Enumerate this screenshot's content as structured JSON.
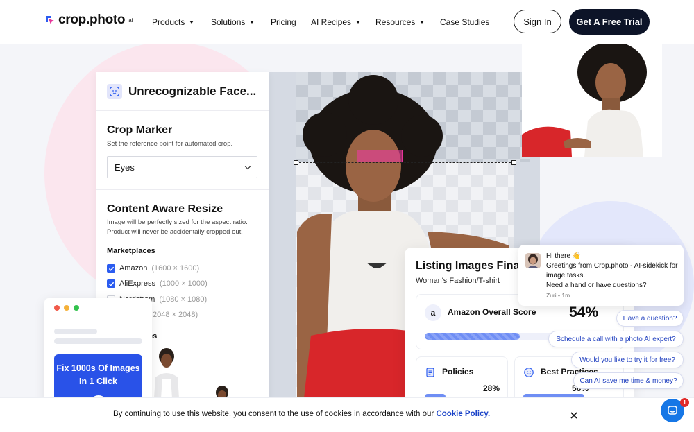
{
  "brand": {
    "name": "crop.photo",
    "sup": "ai"
  },
  "nav": {
    "items": [
      {
        "label": "Products",
        "has_caret": true
      },
      {
        "label": "Solutions",
        "has_caret": true
      },
      {
        "label": "Pricing",
        "has_caret": false
      },
      {
        "label": "AI Recipes",
        "has_caret": true
      },
      {
        "label": "Resources",
        "has_caret": true
      },
      {
        "label": "Case Studies",
        "has_caret": false
      }
    ],
    "signin_label": "Sign In",
    "trial_label": "Get A Free Trial"
  },
  "panel": {
    "title": "Unrecognizable Face...",
    "crop_marker": {
      "title": "Crop Marker",
      "subtitle": "Set the reference point for automated crop.",
      "selected": "Eyes"
    },
    "resize": {
      "title": "Content Aware Resize",
      "subtitle_1": "Image will be perfectly sized for the aspect ratio.",
      "subtitle_2": "Product will never be accidentally cropped out."
    },
    "marketplaces": {
      "title": "Marketplaces",
      "items": [
        {
          "name": "Amazon",
          "dims": "(1600 × 1600)",
          "checked": true
        },
        {
          "name": "AliExpress",
          "dims": "(1000 × 1000)",
          "checked": true
        },
        {
          "name": "Nordstrom",
          "dims": "(1080 × 1080)",
          "checked": false
        },
        {
          "name": "",
          "dims": "2048 × 2048)",
          "checked": false
        }
      ],
      "partial": "es"
    }
  },
  "listing": {
    "title": "Listing Images Final",
    "subtitle": "Woman's Fashion/T-shirt",
    "amazon_score": {
      "label": "Amazon Overall Score",
      "value": "54%",
      "fill": 0.49
    },
    "policies": {
      "label": "Policies",
      "value": "28%",
      "fill": 0.28
    },
    "best_practices": {
      "label": "Best Practices",
      "value": "56%",
      "fill": 0.6
    }
  },
  "mock": {
    "cta": "Fix 1000s Of Images In 1 Click"
  },
  "chat": {
    "greeting": "Hi there 👋",
    "line1": "Greetings from Crop.photo - AI-sidekick for image tasks.",
    "line2": "Need a hand or have questions?",
    "meta": "Zuri • 1m",
    "quick_replies": [
      "Have a question?",
      "Schedule a call with a photo AI expert?",
      "Would you like to try it for free?",
      "Can AI save me time & money?"
    ],
    "badge": "1"
  },
  "cookie": {
    "text": "By continuing to use this website, you consent to the use of cookies in accordance with our ",
    "link": "Cookie Policy."
  },
  "colors": {
    "primary_dark": "#0d1428",
    "accent_blue": "#2b5cf0",
    "eye_marker": "#e6359a"
  }
}
